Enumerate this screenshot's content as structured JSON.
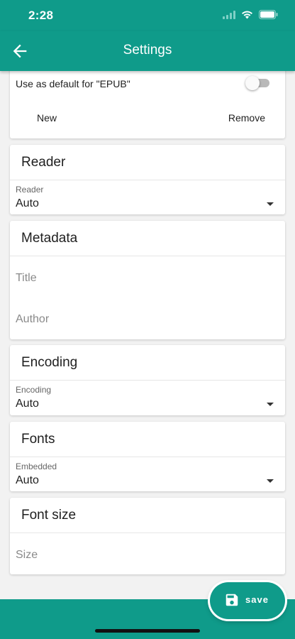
{
  "status_bar": {
    "time": "2:28"
  },
  "app_bar": {
    "title": "Settings"
  },
  "default_card": {
    "toggle_label": "Use as default for \"EPUB\"",
    "toggle_on": false,
    "new_label": "New",
    "remove_label": "Remove"
  },
  "reader_card": {
    "title": "Reader",
    "field_label": "Reader",
    "field_value": "Auto"
  },
  "metadata_card": {
    "title": "Metadata",
    "title_placeholder": "Title",
    "author_placeholder": "Author"
  },
  "encoding_card": {
    "title": "Encoding",
    "field_label": "Encoding",
    "field_value": "Auto"
  },
  "fonts_card": {
    "title": "Fonts",
    "field_label": "Embedded",
    "field_value": "Auto"
  },
  "font_size_card": {
    "title": "Font size",
    "size_placeholder": "Size"
  },
  "fab": {
    "label": "save"
  },
  "colors": {
    "accent": "#0f9b8a"
  }
}
